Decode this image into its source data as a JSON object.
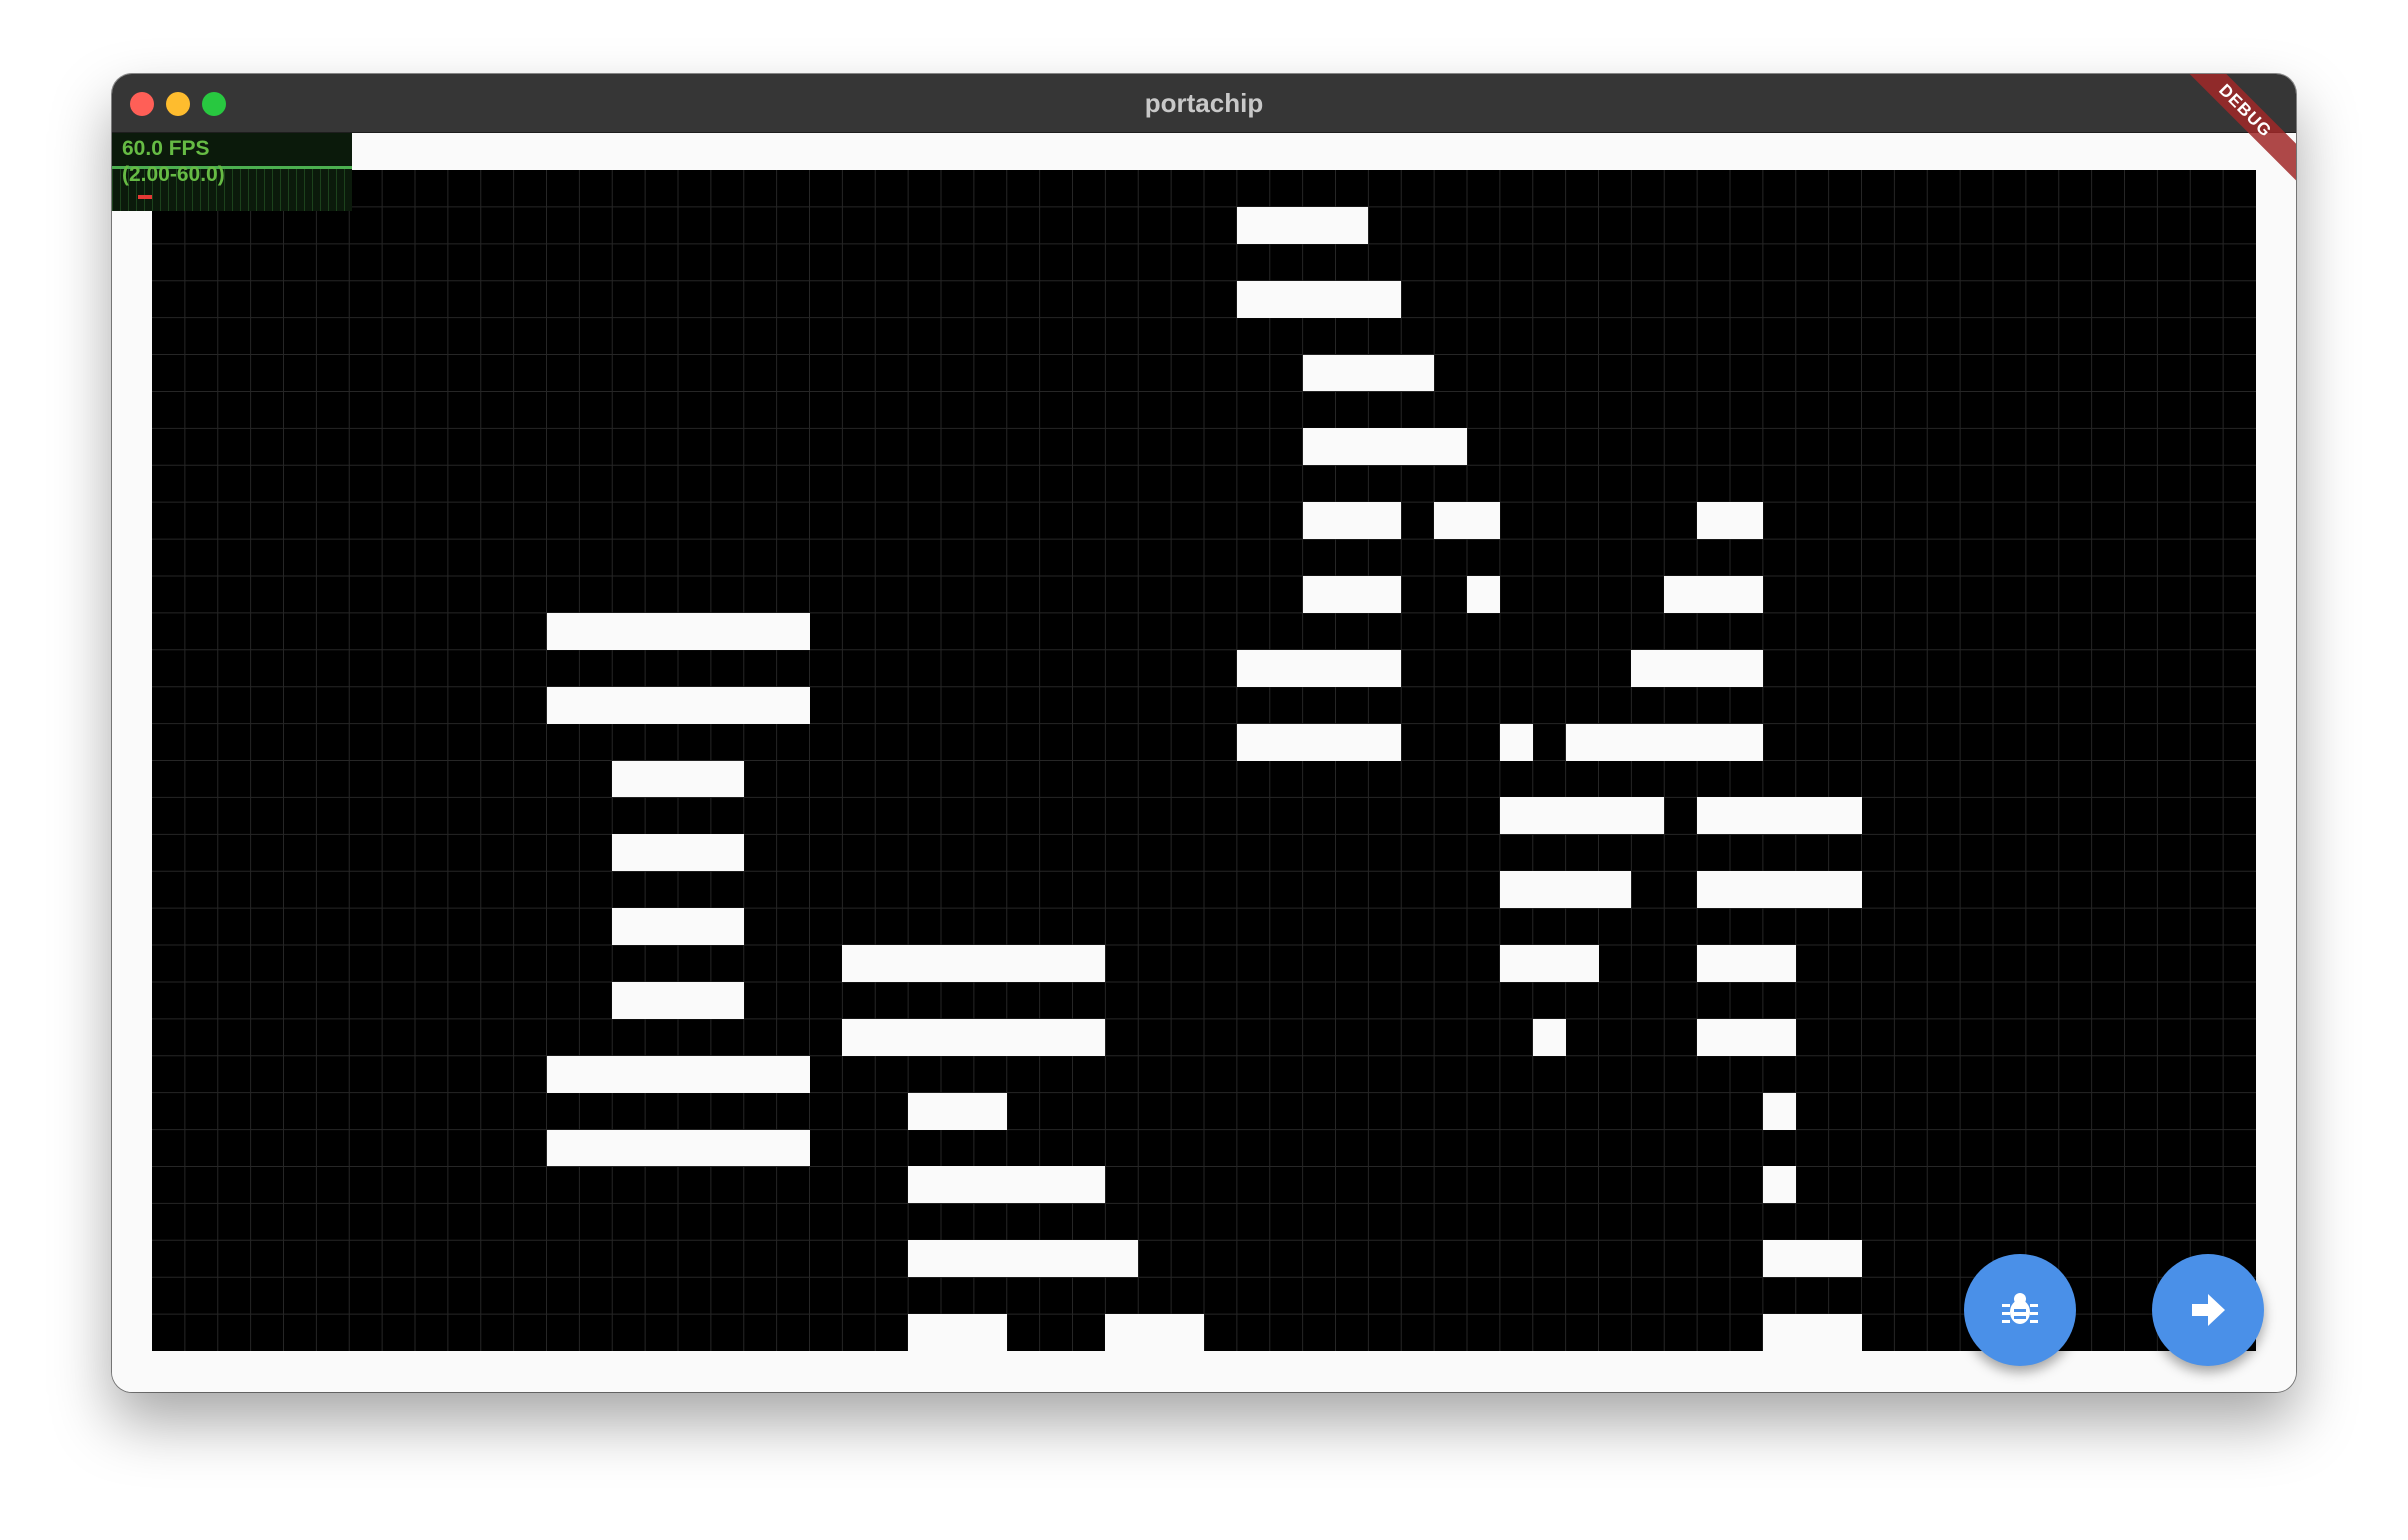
{
  "window": {
    "title": "portachip"
  },
  "perf_overlay": {
    "fps": "60.0 FPS",
    "range": "(2.00-60.0)"
  },
  "debug_banner": "DEBUG",
  "display": {
    "cols": 64,
    "rows": 32,
    "background": "#000000",
    "pixel_color": "#fafafa",
    "grid_color": "#262626",
    "lit_rows": [
      [
        1,
        33,
        37
      ],
      [
        3,
        33,
        38
      ],
      [
        5,
        35,
        39
      ],
      [
        7,
        35,
        40
      ],
      [
        9,
        35,
        38
      ],
      [
        9,
        39,
        41
      ],
      [
        9,
        47,
        49
      ],
      [
        11,
        35,
        38
      ],
      [
        11,
        40,
        41
      ],
      [
        11,
        46,
        49
      ],
      [
        12,
        12,
        20
      ],
      [
        13,
        33,
        38
      ],
      [
        13,
        45,
        49
      ],
      [
        14,
        12,
        20
      ],
      [
        15,
        33,
        38
      ],
      [
        15,
        41,
        42
      ],
      [
        15,
        43,
        49
      ],
      [
        16,
        14,
        18
      ],
      [
        17,
        41,
        46
      ],
      [
        17,
        47,
        52
      ],
      [
        18,
        14,
        18
      ],
      [
        19,
        41,
        45
      ],
      [
        19,
        47,
        52
      ],
      [
        20,
        14,
        18
      ],
      [
        21,
        21,
        29
      ],
      [
        21,
        41,
        44
      ],
      [
        21,
        47,
        50
      ],
      [
        22,
        14,
        18
      ],
      [
        23,
        21,
        29
      ],
      [
        23,
        42,
        43
      ],
      [
        23,
        47,
        50
      ],
      [
        24,
        12,
        20
      ],
      [
        25,
        23,
        26
      ],
      [
        25,
        49,
        50
      ],
      [
        26,
        12,
        20
      ],
      [
        27,
        23,
        29
      ],
      [
        27,
        49,
        50
      ],
      [
        29,
        23,
        30
      ],
      [
        29,
        49,
        52
      ],
      [
        31,
        23,
        26
      ],
      [
        31,
        29,
        32
      ],
      [
        31,
        49,
        52
      ]
    ]
  },
  "buttons": {
    "debug_icon": "bug-icon",
    "step_icon": "arrow-right-icon",
    "accent": "#4a90e8"
  }
}
